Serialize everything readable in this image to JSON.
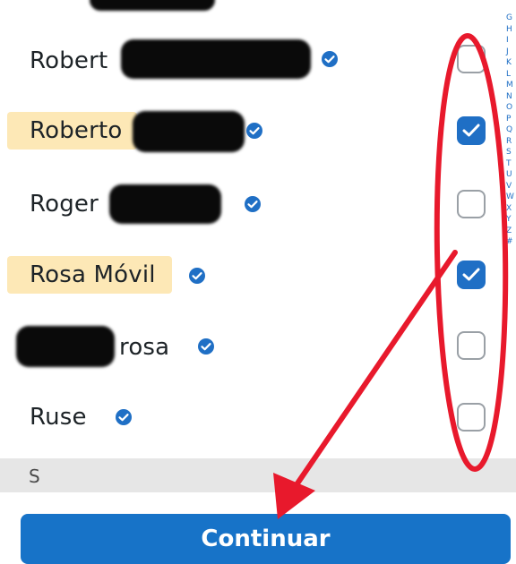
{
  "contacts": [
    {
      "name": "Robert",
      "checked": false,
      "highlighted": false
    },
    {
      "name": "Roberto",
      "checked": true,
      "highlighted": true
    },
    {
      "name": "Roger",
      "checked": false,
      "highlighted": false
    },
    {
      "name": "Rosa Móvil",
      "checked": true,
      "highlighted": true
    },
    {
      "name": "rosa",
      "checked": false,
      "highlighted": false
    },
    {
      "name": "Ruse",
      "checked": false,
      "highlighted": false
    }
  ],
  "section": {
    "letter": "S"
  },
  "index_letters": [
    "G",
    "H",
    "I",
    "J",
    "K",
    "L",
    "M",
    "N",
    "O",
    "P",
    "Q",
    "R",
    "S",
    "T",
    "U",
    "V",
    "W",
    "X",
    "Y",
    "Z",
    "#"
  ],
  "continue_label": "Continuar",
  "colors": {
    "accent": "#1773c8",
    "checkbox_checked": "#1f6fc5",
    "highlight": "#fde8b6",
    "annotation": "#e8192c"
  },
  "icons": {
    "verified": "verified-check-icon",
    "checkmark": "checkmark-icon"
  }
}
